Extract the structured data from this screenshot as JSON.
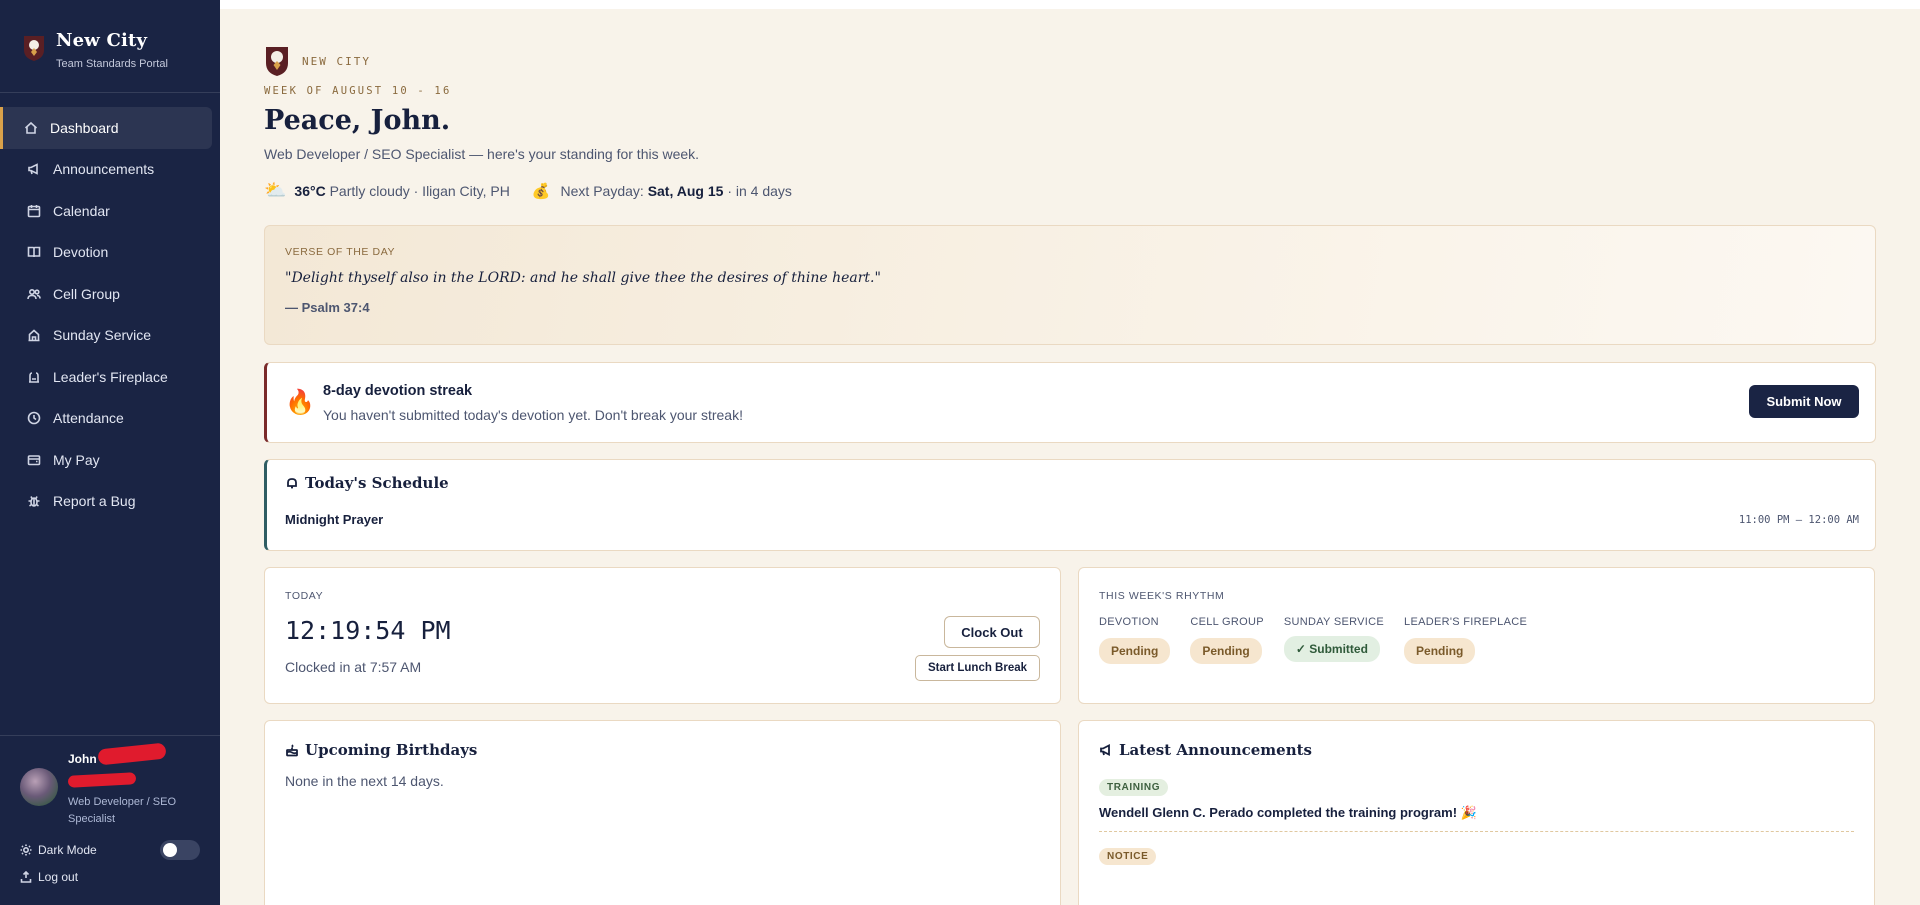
{
  "brand": {
    "title": "New City",
    "subtitle": "Team Standards Portal"
  },
  "nav": [
    {
      "label": "Dashboard",
      "icon": "home-icon",
      "active": true
    },
    {
      "label": "Announcements",
      "icon": "megaphone-icon"
    },
    {
      "label": "Calendar",
      "icon": "calendar-icon"
    },
    {
      "label": "Devotion",
      "icon": "book-icon"
    },
    {
      "label": "Cell Group",
      "icon": "users-icon"
    },
    {
      "label": "Sunday Service",
      "icon": "church-icon"
    },
    {
      "label": "Leader's Fireplace",
      "icon": "fireplace-icon"
    },
    {
      "label": "Attendance",
      "icon": "clock-icon"
    },
    {
      "label": "My Pay",
      "icon": "wallet-icon"
    },
    {
      "label": "Report a Bug",
      "icon": "bug-icon"
    }
  ],
  "user": {
    "name": "John",
    "role": "Web Developer / SEO Specialist"
  },
  "settings": {
    "dark_mode_label": "Dark Mode",
    "dark_mode_on": false,
    "logout_label": "Log out"
  },
  "header": {
    "org": "NEW CITY",
    "week": "WEEK OF AUGUST 10 - 16",
    "greeting": "Peace, John.",
    "subline": "Web Developer / SEO Specialist — here's your standing for this week.",
    "temp": "36°C",
    "weather": "Partly cloudy · Iligan City, PH",
    "payday_label": "Next Payday:",
    "payday_date": "Sat, Aug 15",
    "payday_rel": "· in 4 days"
  },
  "verse": {
    "label": "VERSE OF THE DAY",
    "text": "\"Delight thyself also in the LORD: and he shall give thee the desires of thine heart.\"",
    "ref": "— Psalm 37:4"
  },
  "streak": {
    "title": "8-day devotion streak",
    "message": "You haven't submitted today's devotion yet. Don't break your streak!",
    "button": "Submit Now"
  },
  "schedule": {
    "title": "Today's Schedule",
    "items": [
      {
        "name": "Midnight Prayer",
        "time": "11:00 PM – 12:00 AM"
      }
    ]
  },
  "today": {
    "label": "TODAY",
    "clock": "12:19:54 PM",
    "clocked_in": "Clocked in at 7:57 AM",
    "clock_out_label": "Clock Out",
    "lunch_label": "Start Lunch Break"
  },
  "rhythm": {
    "label": "THIS WEEK'S RHYTHM",
    "items": [
      {
        "label": "DEVOTION",
        "status": "Pending"
      },
      {
        "label": "CELL GROUP",
        "status": "Pending"
      },
      {
        "label": "SUNDAY SERVICE",
        "status": "✓ Submitted"
      },
      {
        "label": "LEADER'S FIREPLACE",
        "status": "Pending"
      }
    ]
  },
  "birthdays": {
    "title": "Upcoming Birthdays",
    "empty": "None in the next 14 days."
  },
  "announcements": {
    "title": "Latest Announcements",
    "items": [
      {
        "tag": "TRAINING",
        "text": "Wendell Glenn C. Perado completed the training program! 🎉"
      },
      {
        "tag": "NOTICE",
        "text": ""
      }
    ]
  },
  "colors": {
    "sidebar": "#1a2444",
    "accent": "#d9a14a",
    "background": "#f8f3ea"
  }
}
